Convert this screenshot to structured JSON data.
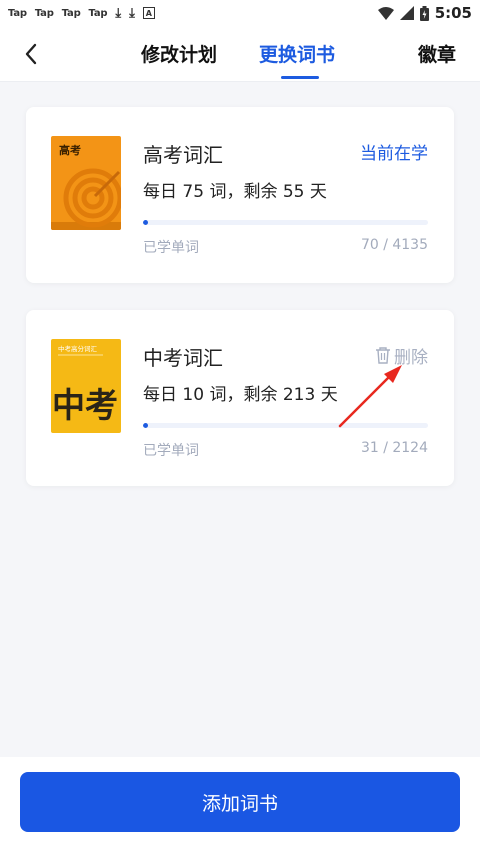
{
  "status_bar": {
    "left_items": [
      "Tap",
      "Tap",
      "Tap",
      "Tap"
    ],
    "time": "5:05",
    "icons": [
      "download-icon",
      "download-icon",
      "a-icon",
      "wifi-icon",
      "signal-icon",
      "battery-icon"
    ]
  },
  "nav": {
    "back_icon": "chevron-left-icon",
    "tabs": [
      {
        "label": "修改计划",
        "active": false
      },
      {
        "label": "更换词书",
        "active": true
      },
      {
        "label": "徽章",
        "active": false
      }
    ],
    "accent": "#1d5be0"
  },
  "books": [
    {
      "title": "高考词汇",
      "subtitle": "每日 75 词，剩余 55 天",
      "status": "当前在学",
      "learned_label": "已学单词",
      "learned": "70 / 4135",
      "progress": 0.017,
      "cover_text": "高考",
      "cover_color": "#f39416"
    },
    {
      "title": "中考词汇",
      "subtitle": "每日 10 词，剩余 213 天",
      "action": "删除",
      "learned_label": "已学单词",
      "learned": "31 / 2124",
      "progress": 0.015,
      "cover_text": "中考高分词汇",
      "cover_big_text": "中考",
      "cover_color": "#f5b915"
    }
  ],
  "add_button": {
    "label": "添加词书",
    "color": "#1a57e3"
  },
  "annotation": {
    "type": "red-arrow",
    "color": "#e8281f"
  }
}
